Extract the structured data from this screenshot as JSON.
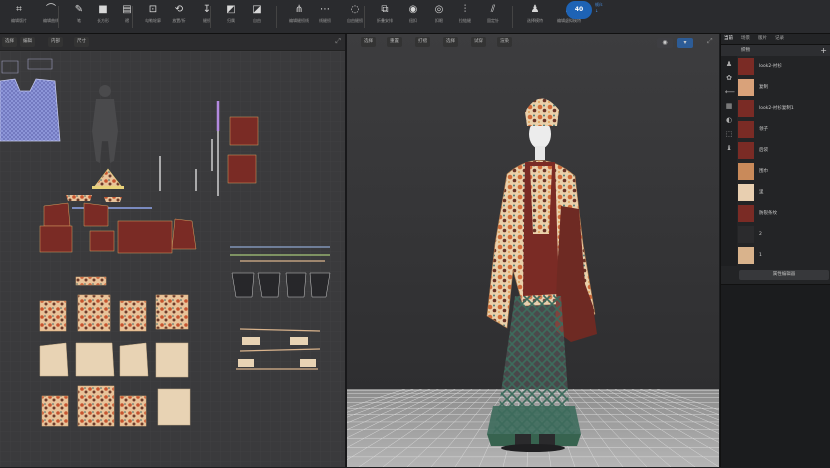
{
  "toolbar": {
    "items": [
      {
        "label": "编辑版片",
        "icon": "⌗"
      },
      {
        "label": "编辑曲线",
        "icon": "⌒"
      },
      {
        "label": "笔",
        "icon": "✎"
      },
      {
        "label": "长方形",
        "icon": "■"
      },
      {
        "label": "褶",
        "icon": "▤"
      },
      {
        "label": "勾勒轮廓",
        "icon": "⊡"
      },
      {
        "label": "放置/折",
        "icon": "⟲"
      },
      {
        "label": "缝纫",
        "icon": "↧"
      },
      {
        "label": "归属",
        "icon": "◩"
      },
      {
        "label": "自由",
        "icon": "◪"
      },
      {
        "label": "编辑缝纫线",
        "icon": "⋔"
      },
      {
        "label": "线缝纫",
        "icon": "⋯"
      },
      {
        "label": "自由缝纫",
        "icon": "◌"
      },
      {
        "label": "折叠安排",
        "icon": "⧉"
      },
      {
        "label": "纽扣",
        "icon": "◉"
      },
      {
        "label": "扣眼",
        "icon": "◎"
      },
      {
        "label": "拉链缝",
        "icon": "⫶"
      },
      {
        "label": "固定针",
        "icon": "⫽"
      },
      {
        "label": "选择模特",
        "icon": "♟"
      },
      {
        "label": "编辑虚拟模特",
        "icon": "♙"
      }
    ],
    "fps": "40",
    "fps_sub_1": "帧/s",
    "fps_sub_2": "↓"
  },
  "panel2d": {
    "tools": [
      "选择",
      "编辑",
      "内部",
      "尺寸"
    ],
    "title": "2D"
  },
  "panel3d": {
    "tools": [
      "选择",
      "重置",
      "打褶",
      "选择",
      "试穿",
      "渲染"
    ],
    "title": "3D"
  },
  "right_panel": {
    "tabs": [
      "当前",
      "场景",
      "版片",
      "记录"
    ],
    "header": "织物",
    "items": [
      {
        "label": "look2-衬衫",
        "color": "#7a2b25"
      },
      {
        "label": "复制",
        "color": "#d9a27a"
      },
      {
        "label": "look2-衬衫复制1",
        "color": "#7a2b25"
      },
      {
        "label": "领子",
        "color": "#7a2b25"
      },
      {
        "label": "后袋",
        "color": "#7a2b25"
      },
      {
        "label": "围巾",
        "color": "#c98a5a"
      },
      {
        "label": "里",
        "color": "#e8cfb0"
      },
      {
        "label": "防裂条纹",
        "color": "#7a2b25"
      },
      {
        "label": "2",
        "color": "#2b2b2d"
      },
      {
        "label": "1",
        "color": "#d9b38c"
      }
    ],
    "button": "属性编辑器",
    "side_icons": [
      "♟",
      "✿",
      "⟵",
      "▦",
      "◐",
      "⬚",
      "♝"
    ]
  },
  "colors": {
    "toolbar_bg": "#2a2b2e",
    "panel2d_bg": "#3a3a3c",
    "accent": "#1e63b5",
    "garment_red": "#7a2b25",
    "garment_print": "#d98a55",
    "garment_beige": "#e8d3b4",
    "skirt_green": "#3d6b5c"
  }
}
